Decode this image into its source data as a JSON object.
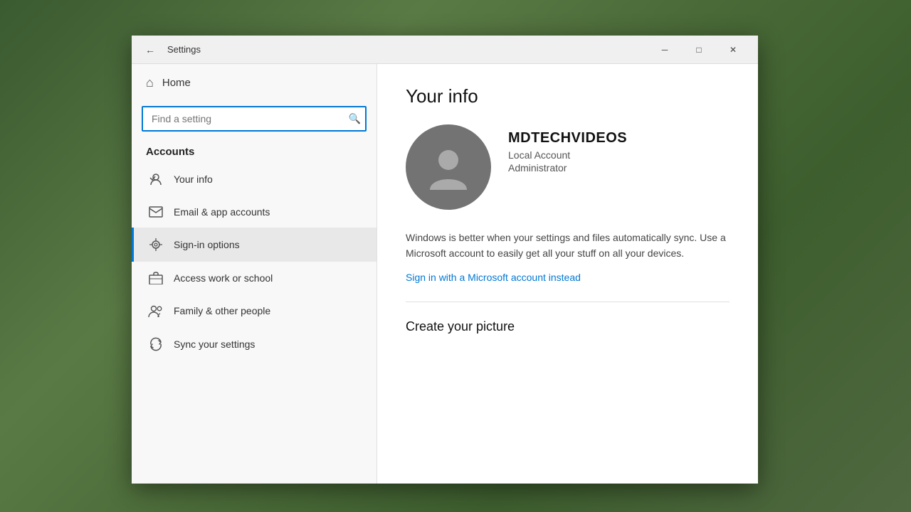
{
  "desktop": {
    "bg_description": "Forest background"
  },
  "window": {
    "title": "Settings",
    "title_bar": {
      "back_label": "←",
      "minimize_label": "─",
      "maximize_label": "□",
      "close_label": "✕"
    }
  },
  "sidebar": {
    "home_label": "Home",
    "search_placeholder": "Find a setting",
    "search_icon": "🔍",
    "section_header": "Accounts",
    "nav_items": [
      {
        "id": "your-info",
        "label": "Your info",
        "icon": "person"
      },
      {
        "id": "email-app-accounts",
        "label": "Email & app accounts",
        "icon": "email"
      },
      {
        "id": "sign-in-options",
        "label": "Sign-in options",
        "icon": "key",
        "active": true
      },
      {
        "id": "access-work-school",
        "label": "Access work or school",
        "icon": "briefcase"
      },
      {
        "id": "family-other-people",
        "label": "Family & other people",
        "icon": "group"
      },
      {
        "id": "sync-settings",
        "label": "Sync your settings",
        "icon": "sync"
      }
    ]
  },
  "main": {
    "page_title": "Your info",
    "username": "MDTECHVIDEOS",
    "account_type": "Local Account",
    "account_role": "Administrator",
    "sync_message": "Windows is better when your settings and files automatically sync. Use a Microsoft account to easily get all your stuff on all your devices.",
    "ms_link_label": "Sign in with a Microsoft account instead",
    "create_picture_title": "Create your picture"
  }
}
